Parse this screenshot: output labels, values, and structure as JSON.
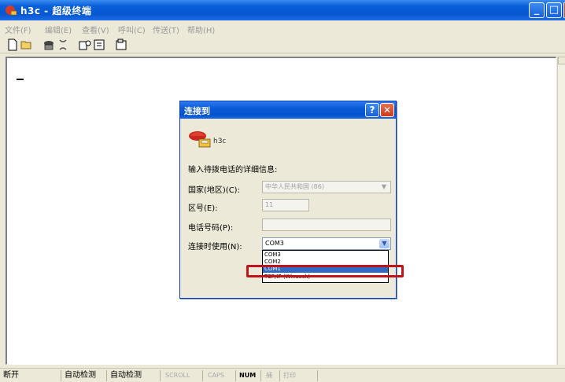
{
  "window": {
    "title": "h3c - 超级终端"
  },
  "menu": {
    "items": [
      "文件(F)",
      "编辑(E)",
      "查看(V)",
      "呼叫(C)",
      "传送(T)",
      "帮助(H)"
    ]
  },
  "toolbar": {
    "icons": [
      "new-icon",
      "open-icon",
      "connect-icon",
      "disconnect-icon",
      "send-icon",
      "receive-icon",
      "properties-icon"
    ]
  },
  "statusbar": {
    "cells": [
      "断开",
      "自动检测",
      "自动检测",
      "SCROLL",
      "CAPS",
      "NUM",
      "捕",
      "打印"
    ]
  },
  "dialog": {
    "title": "连接到",
    "help_label": "?",
    "close_label": "✕",
    "connection_name": "h3c",
    "prompt": "输入待拨电话的详细信息:",
    "country_label": "国家(地区)(C):",
    "country_value": "中华人民共和国 (86)",
    "area_label": "区号(E):",
    "area_value": "11",
    "phone_label": "电话号码(P):",
    "phone_value": "",
    "connect_label": "连接时使用(N):",
    "connect_selected": "COM3",
    "connect_options": [
      "COM3",
      "COM2",
      "COM1",
      "TCP/IP (Winsock)"
    ],
    "highlighted_option": "COM1"
  },
  "colors": {
    "titlebar": "#0a5fd8",
    "highlight": "#c0141c",
    "selection": "#316ac5"
  }
}
